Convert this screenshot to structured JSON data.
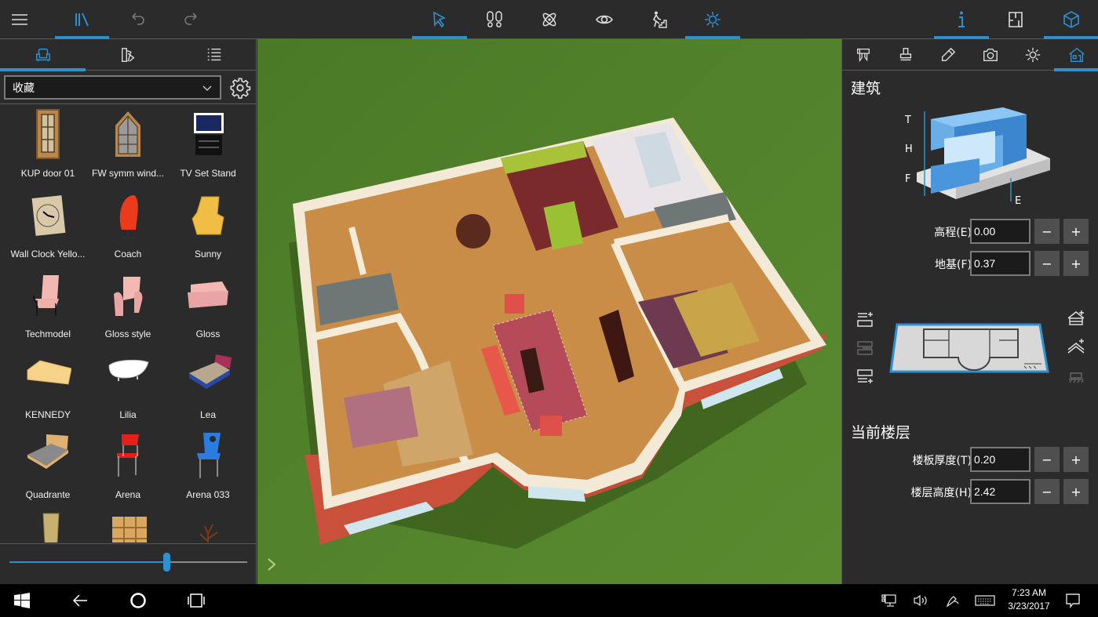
{
  "toolbar": {
    "left": [
      {
        "icon": "hamburger-menu-icon"
      },
      {
        "icon": "library-icon",
        "active": true
      },
      {
        "icon": "undo-icon"
      },
      {
        "icon": "redo-icon"
      }
    ],
    "center": [
      {
        "icon": "select-arrow-icon",
        "active": true
      },
      {
        "icon": "footprints-icon"
      },
      {
        "icon": "atom-icon"
      },
      {
        "icon": "eye-icon"
      },
      {
        "icon": "walk-stairs-icon"
      },
      {
        "icon": "sun-icon",
        "active": true
      }
    ],
    "right": [
      {
        "icon": "info-icon",
        "active": true
      },
      {
        "icon": "floorplan-2d-icon"
      },
      {
        "icon": "cube-3d-icon",
        "active": true
      }
    ]
  },
  "library": {
    "tabs": [
      {
        "icon": "furniture-armchair-icon",
        "active": true
      },
      {
        "icon": "material-swatches-icon"
      },
      {
        "icon": "list-icon"
      }
    ],
    "category": "收藏",
    "items": [
      {
        "label": "KUP door 01",
        "kind": "door"
      },
      {
        "label": "FW symm wind...",
        "kind": "window"
      },
      {
        "label": "TV Set Stand",
        "kind": "tv"
      },
      {
        "label": "Wall Clock Yello...",
        "kind": "clock"
      },
      {
        "label": "Coach",
        "kind": "eggchair"
      },
      {
        "label": "Sunny",
        "kind": "armchair-yellow"
      },
      {
        "label": "Techmodel",
        "kind": "chair-pink"
      },
      {
        "label": "Gloss style",
        "kind": "armchair-pink"
      },
      {
        "label": "Gloss",
        "kind": "sofa-pink"
      },
      {
        "label": "KENNEDY",
        "kind": "sofa-yellow"
      },
      {
        "label": "Lilia",
        "kind": "bathtub"
      },
      {
        "label": "Lea",
        "kind": "bed-blue"
      },
      {
        "label": "Quadrante",
        "kind": "bed-grey"
      },
      {
        "label": "Arena",
        "kind": "chair-red"
      },
      {
        "label": "Arena 033",
        "kind": "chair-blue"
      },
      {
        "label": "",
        "kind": "chair-wood"
      },
      {
        "label": "",
        "kind": "shelf"
      },
      {
        "label": "",
        "kind": "tree"
      }
    ],
    "zoom_slider_fraction": 0.66
  },
  "viewport": {
    "expand_icon": "chevron-right-icon"
  },
  "properties": {
    "tabs": [
      {
        "icon": "caliper-icon"
      },
      {
        "icon": "stamp-brush-icon"
      },
      {
        "icon": "pencil-icon"
      },
      {
        "icon": "camera-icon"
      },
      {
        "icon": "sun-icon"
      },
      {
        "icon": "house-icon",
        "active": true
      }
    ],
    "building_title": "建筑",
    "diagram_labels": {
      "T": "T",
      "H": "H",
      "F": "F",
      "E": "E"
    },
    "elevation": {
      "label": "高程(E)",
      "value": "0.00"
    },
    "foundation": {
      "label": "地基(F)",
      "value": "0.37"
    },
    "level_actions_left": [
      "add-level-above-icon",
      "delete-level-icon",
      "add-level-below-icon"
    ],
    "level_actions_right": [
      "add-roof-icon",
      "add-upper-level-icon",
      "ground-level-icon"
    ],
    "current_floor_title": "当前楼层",
    "slab_thickness": {
      "label": "楼板厚度(T)",
      "value": "0.20"
    },
    "floor_height": {
      "label": "楼层高度(H)",
      "value": "2.42"
    },
    "minus": "−",
    "plus": "+"
  },
  "taskbar": {
    "time": "7:23 AM",
    "date": "3/23/2017"
  },
  "colors": {
    "accent": "#2e8fd1",
    "panel": "#2b2b2b",
    "grass": "#4f7a2a"
  }
}
